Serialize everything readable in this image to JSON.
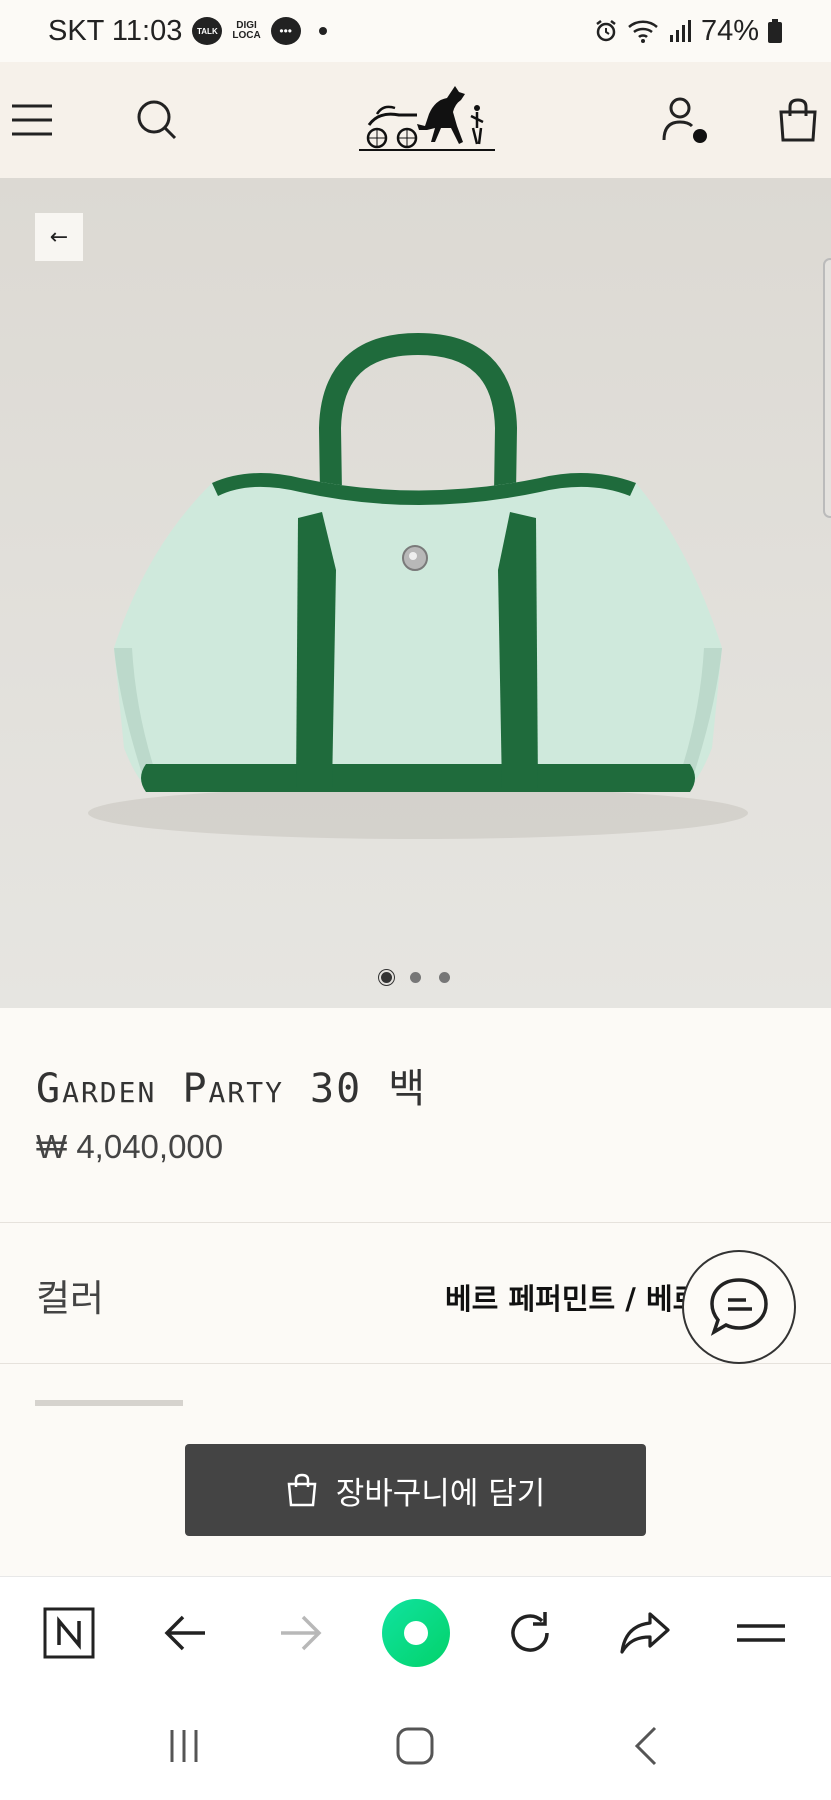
{
  "status_bar": {
    "carrier_time": "SKT 11:03",
    "talk_badge": "TALK",
    "digi_top": "DIGI",
    "digi_bottom": "LOCA",
    "battery": "74%"
  },
  "header": {
    "icons": [
      "menu-icon",
      "search-icon",
      "brand-logo",
      "account-icon",
      "shopping-bag-icon"
    ]
  },
  "hero": {
    "back_label": "←",
    "carousel_total": 3,
    "carousel_active": 1
  },
  "product": {
    "name": "Garden Party 30 백",
    "price": "₩ 4,040,000"
  },
  "color": {
    "label": "컬러",
    "value": "베르 페퍼민트 / 베르 …"
  },
  "cart": {
    "label": "장바구니에 담기"
  },
  "colors": {
    "bag_canvas": "#cfe9dc",
    "bag_leather": "#1f6b3c",
    "cart_button": "#444444",
    "browser_accent": "#03e88a"
  }
}
